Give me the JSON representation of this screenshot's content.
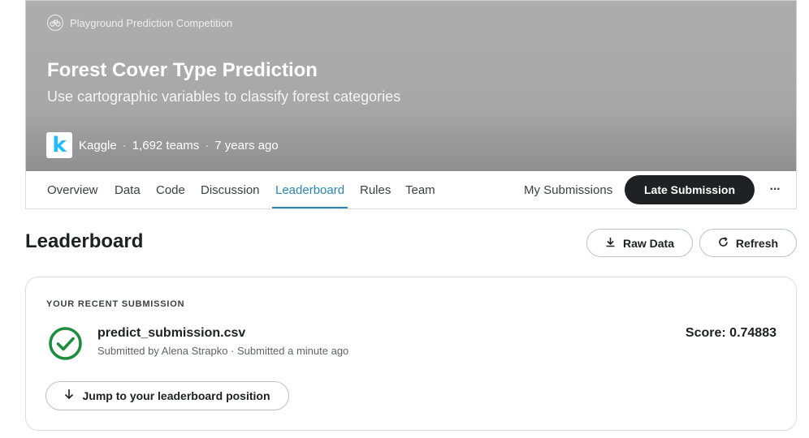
{
  "banner": {
    "tag": "Playground Prediction Competition",
    "title": "Forest Cover Type Prediction",
    "subtitle": "Use cartographic variables to classify forest categories",
    "org_logo_letter": "k",
    "org": "Kaggle",
    "teams": "1,692 teams",
    "age": "7 years ago",
    "separator": "·"
  },
  "tabs": [
    {
      "label": "Overview"
    },
    {
      "label": "Data"
    },
    {
      "label": "Code"
    },
    {
      "label": "Discussion"
    },
    {
      "label": "Leaderboard",
      "active": true
    },
    {
      "label": "Rules"
    },
    {
      "label": "Team"
    }
  ],
  "actions": {
    "my_submissions": "My Submissions",
    "late_submission": "Late Submission",
    "more": "···"
  },
  "leaderboard": {
    "title": "Leaderboard",
    "raw_data": "Raw Data",
    "refresh": "Refresh"
  },
  "recent": {
    "label": "YOUR RECENT SUBMISSION",
    "file": "predict_submission.csv",
    "meta": "Submitted by Alena Strapko · Submitted a minute ago",
    "score": "Score: 0.74883",
    "jump": "Jump to your leaderboard position"
  },
  "icons": {
    "tag": "bike-icon",
    "raw_data": "download-icon",
    "refresh": "refresh-icon",
    "status": "check-circle-icon",
    "jump": "arrow-down-icon"
  },
  "colors": {
    "accent": "#2a86b5",
    "success": "#1e8e3e",
    "dark_button": "#202124",
    "kaggle_blue": "#20beff"
  }
}
